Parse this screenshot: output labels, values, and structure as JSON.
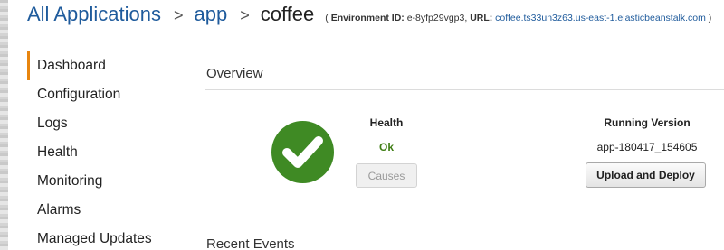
{
  "breadcrumb": {
    "all_applications": "All Applications",
    "separator_1": ">",
    "app": "app",
    "separator_2": ">",
    "current": "coffee",
    "env_open": "( ",
    "env_id_label": "Environment ID:",
    "env_id_value": " e-8yfp29vgp3, ",
    "url_label": "URL:",
    "url_value": " coffee.ts33un3z63.us-east-1.elasticbeanstalk.com",
    "env_close": " )"
  },
  "sidebar": {
    "items": [
      {
        "label": "Dashboard",
        "active": true
      },
      {
        "label": "Configuration"
      },
      {
        "label": "Logs"
      },
      {
        "label": "Health"
      },
      {
        "label": "Monitoring"
      },
      {
        "label": "Alarms"
      },
      {
        "label": "Managed Updates"
      }
    ]
  },
  "overview": {
    "title": "Overview",
    "status_icon": "checkmark-circle-icon",
    "status_color": "#3f8a24",
    "health_label": "Health",
    "health_value": "Ok",
    "health_value_color": "#3e7d13",
    "causes_button": "Causes",
    "running_version_label": "Running Version",
    "running_version_value": "app-180417_154605",
    "upload_deploy_button": "Upload and Deploy"
  },
  "recent_events": {
    "title": "Recent Events"
  },
  "colors": {
    "link": "#1f5b9c",
    "active_accent": "#e8850f"
  }
}
